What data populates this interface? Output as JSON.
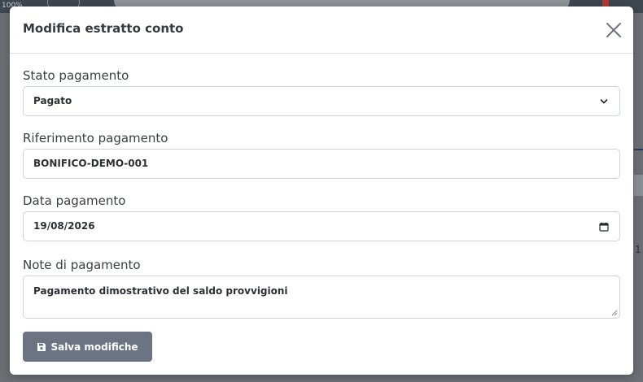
{
  "background": {
    "zoom_label": "100%",
    "side_number": "1"
  },
  "modal": {
    "title": "Modifica estratto conto"
  },
  "form": {
    "stato": {
      "label": "Stato pagamento",
      "value": "Pagato"
    },
    "riferimento": {
      "label": "Riferimento pagamento",
      "value": "BONIFICO-DEMO-001"
    },
    "data": {
      "label": "Data pagamento",
      "value": "19/08/2026"
    },
    "note": {
      "label": "Note di pagamento",
      "value": "Pagamento dimostrativo del saldo provvigioni"
    }
  },
  "actions": {
    "save_label": "Salva modifiche"
  },
  "icons": {
    "close": "close-icon",
    "select_arrow": "chevron-down-icon",
    "date_picker": "calendar-icon",
    "save": "floppy-disk-icon"
  },
  "colors": {
    "save_button": "#6c7484",
    "overlay": "#6b6f73",
    "field_border": "#ced4da"
  }
}
